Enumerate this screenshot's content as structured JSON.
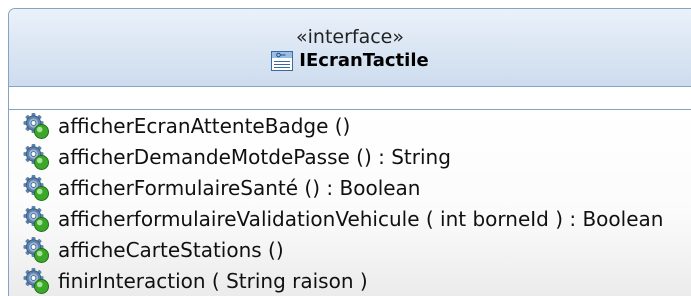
{
  "diagram": {
    "stereotype": "«interface»",
    "name": "IEcranTactile",
    "name_icon": "interface-icon",
    "attributes": [],
    "operations": [
      {
        "icon": "operation-icon",
        "label": "afficherEcranAttenteBadge ()"
      },
      {
        "icon": "operation-icon",
        "label": "afficherDemandeMotdePasse () : String"
      },
      {
        "icon": "operation-icon",
        "label": "afficherFormulaireSanté () : Boolean"
      },
      {
        "icon": "operation-icon",
        "label": "afficherformulaireValidationVehicule ( int borneId ) : Boolean"
      },
      {
        "icon": "operation-icon",
        "label": "afficheCarteStations ()"
      },
      {
        "icon": "operation-icon",
        "label": "finirInteraction ( String raison )"
      }
    ]
  },
  "colors": {
    "header_top": "#eaf1f9",
    "header_bottom": "#cddcee",
    "border": "#86a3c6",
    "operation_gear": "#5d82ad",
    "operation_badge": "#3ca82a",
    "interface_icon": "#3c6aa0"
  }
}
